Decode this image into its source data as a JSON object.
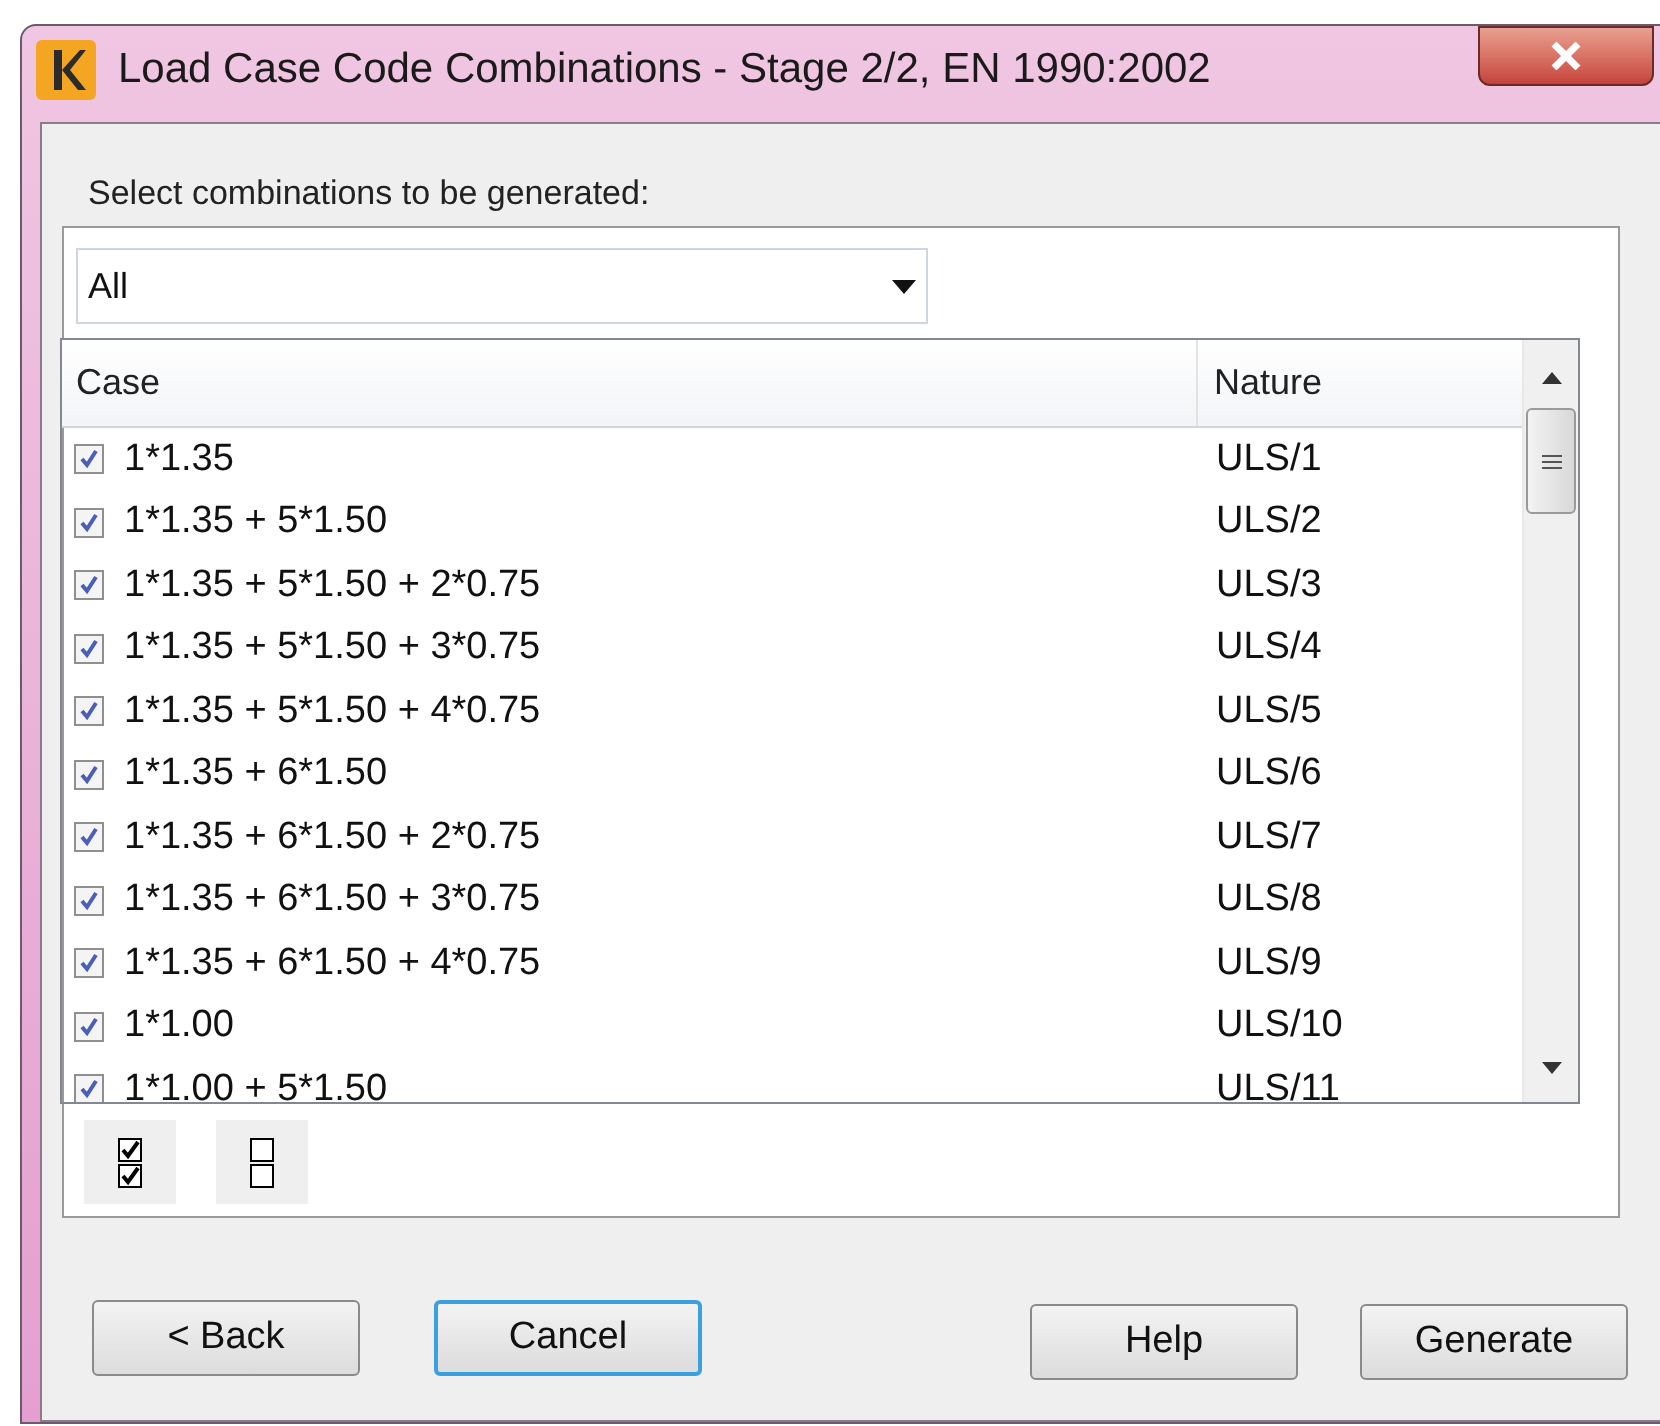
{
  "window": {
    "title": "Load Case Code Combinations - Stage 2/2, EN 1990:2002"
  },
  "prompt": "Select combinations to be generated:",
  "filter": {
    "value": "All"
  },
  "table": {
    "columns": [
      "Case",
      "Nature"
    ],
    "rows": [
      {
        "case": "1*1.35",
        "nature": "ULS/1",
        "checked": true
      },
      {
        "case": "1*1.35 + 5*1.50",
        "nature": "ULS/2",
        "checked": true
      },
      {
        "case": "1*1.35 + 5*1.50 + 2*0.75",
        "nature": "ULS/3",
        "checked": true
      },
      {
        "case": "1*1.35 + 5*1.50 + 3*0.75",
        "nature": "ULS/4",
        "checked": true
      },
      {
        "case": "1*1.35 + 5*1.50 + 4*0.75",
        "nature": "ULS/5",
        "checked": true
      },
      {
        "case": "1*1.35 + 6*1.50",
        "nature": "ULS/6",
        "checked": true
      },
      {
        "case": "1*1.35 + 6*1.50 + 2*0.75",
        "nature": "ULS/7",
        "checked": true
      },
      {
        "case": "1*1.35 + 6*1.50 + 3*0.75",
        "nature": "ULS/8",
        "checked": true
      },
      {
        "case": "1*1.35 + 6*1.50 + 4*0.75",
        "nature": "ULS/9",
        "checked": true
      },
      {
        "case": "1*1.00",
        "nature": "ULS/10",
        "checked": true
      },
      {
        "case": "1*1.00 + 5*1.50",
        "nature": "ULS/11",
        "checked": true
      }
    ]
  },
  "buttons": [
    {
      "label": "< Back",
      "kind": "back"
    },
    {
      "label": "Cancel",
      "kind": "cancel"
    },
    {
      "label": "Help",
      "kind": "help"
    },
    {
      "label": "Generate",
      "kind": "generate"
    }
  ]
}
